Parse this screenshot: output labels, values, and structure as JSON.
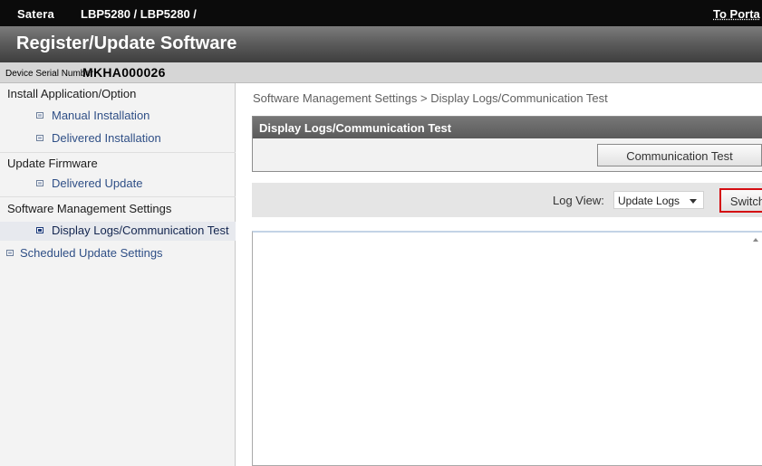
{
  "header": {
    "brand": "Satera",
    "model": "LBP5280 / LBP5280 /",
    "portal_link": "To Porta"
  },
  "page_title": "Register/Update Software",
  "device": {
    "serial_label": "Device Serial Number:",
    "serial_value": "MKHA000026"
  },
  "sidebar": {
    "install_section": "Install Application/Option",
    "manual_installation": "Manual Installation",
    "delivered_installation": "Delivered Installation",
    "update_section": "Update Firmware",
    "delivered_update": "Delivered Update",
    "software_section": "Software Management Settings",
    "display_logs": "Display Logs/Communication Test",
    "scheduled_update": "Scheduled Update Settings"
  },
  "main": {
    "breadcrumb": "Software Management Settings > Display Logs/Communication Test",
    "panel_title": "Display Logs/Communication Test",
    "comm_test_button": "Communication Test",
    "log_view_label": "Log View:",
    "log_view_selected": "Update Logs",
    "switch_button": "Switch",
    "log_content": ""
  }
}
